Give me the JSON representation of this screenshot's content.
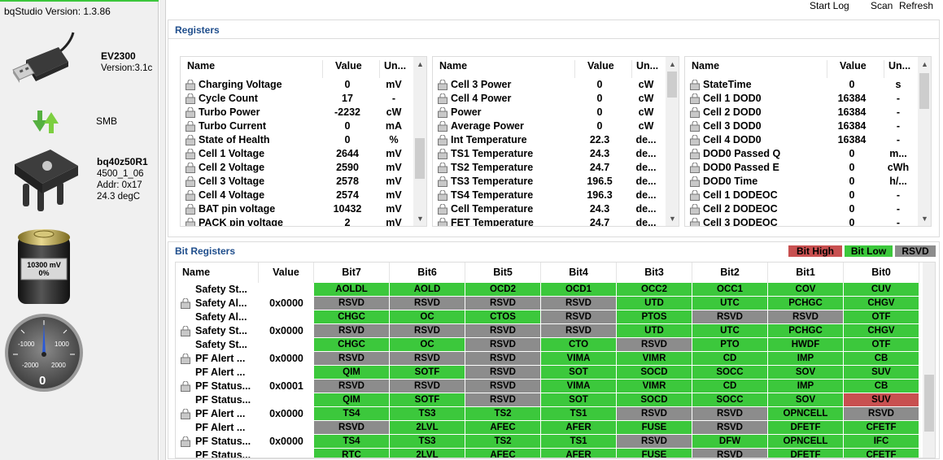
{
  "app": {
    "version_label": "bqStudio Version:",
    "version": "1.3.86"
  },
  "toolbar": {
    "start_log": "Start Log",
    "scan": "Scan",
    "refresh": "Refresh"
  },
  "adapter": {
    "name": "EV2300",
    "version": "Version:3.1c"
  },
  "bus": {
    "label": "SMB"
  },
  "device": {
    "name": "bq40z50R1",
    "fw": "4500_1_06",
    "addr": "Addr: 0x17",
    "temp": "24.3 degC"
  },
  "battery": {
    "voltage": "10300 mV",
    "percent": "0%",
    "level_fraction": 0.0
  },
  "gauge": {
    "ticks": [
      "-1000",
      "1000",
      "-2000",
      "2000"
    ],
    "value": "0",
    "needle_value": 0
  },
  "registers": {
    "title": "Registers",
    "headers": {
      "name": "Name",
      "value": "Value",
      "unit": "Un..."
    },
    "tables": [
      {
        "rows": [
          {
            "name": "Charging Voltage",
            "value": "0",
            "unit": "mV"
          },
          {
            "name": "Cycle Count",
            "value": "17",
            "unit": "-"
          },
          {
            "name": "Turbo Power",
            "value": "-2232",
            "unit": "cW"
          },
          {
            "name": "Turbo Current",
            "value": "0",
            "unit": "mA"
          },
          {
            "name": "State of Health",
            "value": "0",
            "unit": "%"
          },
          {
            "name": "Cell 1 Voltage",
            "value": "2644",
            "unit": "mV"
          },
          {
            "name": "Cell 2 Voltage",
            "value": "2590",
            "unit": "mV"
          },
          {
            "name": "Cell 3 Voltage",
            "value": "2578",
            "unit": "mV"
          },
          {
            "name": "Cell 4 Voltage",
            "value": "2574",
            "unit": "mV"
          },
          {
            "name": "BAT pin voltage",
            "value": "10432",
            "unit": "mV"
          },
          {
            "name": "PACK pin voltage",
            "value": "2",
            "unit": "mV"
          }
        ]
      },
      {
        "rows": [
          {
            "name": "Cell 3 Power",
            "value": "0",
            "unit": "cW"
          },
          {
            "name": "Cell 4 Power",
            "value": "0",
            "unit": "cW"
          },
          {
            "name": "Power",
            "value": "0",
            "unit": "cW"
          },
          {
            "name": "Average Power",
            "value": "0",
            "unit": "cW"
          },
          {
            "name": "Int Temperature",
            "value": "22.3",
            "unit": "de..."
          },
          {
            "name": "TS1 Temperature",
            "value": "24.3",
            "unit": "de..."
          },
          {
            "name": "TS2 Temperature",
            "value": "24.7",
            "unit": "de..."
          },
          {
            "name": "TS3 Temperature",
            "value": "196.5",
            "unit": "de..."
          },
          {
            "name": "TS4 Temperature",
            "value": "196.3",
            "unit": "de..."
          },
          {
            "name": "Cell Temperature",
            "value": "24.3",
            "unit": "de..."
          },
          {
            "name": "FET Temperature",
            "value": "24.7",
            "unit": "de..."
          }
        ]
      },
      {
        "rows": [
          {
            "name": "StateTime",
            "value": "0",
            "unit": "s"
          },
          {
            "name": "Cell 1 DOD0",
            "value": "16384",
            "unit": "-"
          },
          {
            "name": "Cell 2 DOD0",
            "value": "16384",
            "unit": "-"
          },
          {
            "name": "Cell 3 DOD0",
            "value": "16384",
            "unit": "-"
          },
          {
            "name": "Cell 4 DOD0",
            "value": "16384",
            "unit": "-"
          },
          {
            "name": "DOD0 Passed Q",
            "value": "0",
            "unit": "m..."
          },
          {
            "name": "DOD0 Passed E",
            "value": "0",
            "unit": "cWh"
          },
          {
            "name": "DOD0 Time",
            "value": "0",
            "unit": "h/..."
          },
          {
            "name": "Cell 1 DODEOC",
            "value": "0",
            "unit": "-"
          },
          {
            "name": "Cell 2 DODEOC",
            "value": "0",
            "unit": "-"
          },
          {
            "name": "Cell 3 DODEOC",
            "value": "0",
            "unit": "-"
          }
        ]
      }
    ]
  },
  "bit_registers": {
    "title": "Bit Registers",
    "legend": {
      "high": "Bit High",
      "low": "Bit Low",
      "rsvd": "RSVD"
    },
    "headers": [
      "Name",
      "Value",
      "Bit7",
      "Bit6",
      "Bit5",
      "Bit4",
      "Bit3",
      "Bit2",
      "Bit1",
      "Bit0"
    ],
    "colors": {
      "low": "#3cc83c",
      "rsvd": "#8c8c8c",
      "high": "#c85050"
    },
    "rows": [
      {
        "name": "Safety St...",
        "value": "",
        "lock": false,
        "bits": [
          [
            "AOLDL",
            "low"
          ],
          [
            "AOLD",
            "low"
          ],
          [
            "OCD2",
            "low"
          ],
          [
            "OCD1",
            "low"
          ],
          [
            "OCC2",
            "low"
          ],
          [
            "OCC1",
            "low"
          ],
          [
            "COV",
            "low"
          ],
          [
            "CUV",
            "low"
          ]
        ]
      },
      {
        "name": "Safety Al...",
        "value": "0x0000",
        "lock": true,
        "bits": [
          [
            "RSVD",
            "rsvd"
          ],
          [
            "RSVD",
            "rsvd"
          ],
          [
            "RSVD",
            "rsvd"
          ],
          [
            "RSVD",
            "rsvd"
          ],
          [
            "UTD",
            "low"
          ],
          [
            "UTC",
            "low"
          ],
          [
            "PCHGC",
            "low"
          ],
          [
            "CHGV",
            "low"
          ]
        ]
      },
      {
        "name": "Safety Al...",
        "value": "",
        "lock": false,
        "bits": [
          [
            "CHGC",
            "low"
          ],
          [
            "OC",
            "low"
          ],
          [
            "CTOS",
            "low"
          ],
          [
            "RSVD",
            "rsvd"
          ],
          [
            "PTOS",
            "low"
          ],
          [
            "RSVD",
            "rsvd"
          ],
          [
            "RSVD",
            "rsvd"
          ],
          [
            "OTF",
            "low"
          ]
        ]
      },
      {
        "name": "Safety St...",
        "value": "0x0000",
        "lock": true,
        "bits": [
          [
            "RSVD",
            "rsvd"
          ],
          [
            "RSVD",
            "rsvd"
          ],
          [
            "RSVD",
            "rsvd"
          ],
          [
            "RSVD",
            "rsvd"
          ],
          [
            "UTD",
            "low"
          ],
          [
            "UTC",
            "low"
          ],
          [
            "PCHGC",
            "low"
          ],
          [
            "CHGV",
            "low"
          ]
        ]
      },
      {
        "name": "Safety St...",
        "value": "",
        "lock": false,
        "bits": [
          [
            "CHGC",
            "low"
          ],
          [
            "OC",
            "low"
          ],
          [
            "RSVD",
            "rsvd"
          ],
          [
            "CTO",
            "low"
          ],
          [
            "RSVD",
            "rsvd"
          ],
          [
            "PTO",
            "low"
          ],
          [
            "HWDF",
            "low"
          ],
          [
            "OTF",
            "low"
          ]
        ]
      },
      {
        "name": "PF Alert ...",
        "value": "0x0000",
        "lock": true,
        "bits": [
          [
            "RSVD",
            "rsvd"
          ],
          [
            "RSVD",
            "rsvd"
          ],
          [
            "RSVD",
            "rsvd"
          ],
          [
            "VIMA",
            "low"
          ],
          [
            "VIMR",
            "low"
          ],
          [
            "CD",
            "low"
          ],
          [
            "IMP",
            "low"
          ],
          [
            "CB",
            "low"
          ]
        ]
      },
      {
        "name": "PF Alert ...",
        "value": "",
        "lock": false,
        "bits": [
          [
            "QIM",
            "low"
          ],
          [
            "SOTF",
            "low"
          ],
          [
            "RSVD",
            "rsvd"
          ],
          [
            "SOT",
            "low"
          ],
          [
            "SOCD",
            "low"
          ],
          [
            "SOCC",
            "low"
          ],
          [
            "SOV",
            "low"
          ],
          [
            "SUV",
            "low"
          ]
        ]
      },
      {
        "name": "PF Status...",
        "value": "0x0001",
        "lock": true,
        "bits": [
          [
            "RSVD",
            "rsvd"
          ],
          [
            "RSVD",
            "rsvd"
          ],
          [
            "RSVD",
            "rsvd"
          ],
          [
            "VIMA",
            "low"
          ],
          [
            "VIMR",
            "low"
          ],
          [
            "CD",
            "low"
          ],
          [
            "IMP",
            "low"
          ],
          [
            "CB",
            "low"
          ]
        ]
      },
      {
        "name": "PF Status...",
        "value": "",
        "lock": false,
        "bits": [
          [
            "QIM",
            "low"
          ],
          [
            "SOTF",
            "low"
          ],
          [
            "RSVD",
            "rsvd"
          ],
          [
            "SOT",
            "low"
          ],
          [
            "SOCD",
            "low"
          ],
          [
            "SOCC",
            "low"
          ],
          [
            "SOV",
            "low"
          ],
          [
            "SUV",
            "high"
          ]
        ]
      },
      {
        "name": "PF Alert ...",
        "value": "0x0000",
        "lock": true,
        "bits": [
          [
            "TS4",
            "low"
          ],
          [
            "TS3",
            "low"
          ],
          [
            "TS2",
            "low"
          ],
          [
            "TS1",
            "low"
          ],
          [
            "RSVD",
            "rsvd"
          ],
          [
            "RSVD",
            "rsvd"
          ],
          [
            "OPNCELL",
            "low"
          ],
          [
            "RSVD",
            "rsvd"
          ]
        ]
      },
      {
        "name": "PF Alert ...",
        "value": "",
        "lock": false,
        "bits": [
          [
            "RSVD",
            "rsvd"
          ],
          [
            "2LVL",
            "low"
          ],
          [
            "AFEC",
            "low"
          ],
          [
            "AFER",
            "low"
          ],
          [
            "FUSE",
            "low"
          ],
          [
            "RSVD",
            "rsvd"
          ],
          [
            "DFETF",
            "low"
          ],
          [
            "CFETF",
            "low"
          ]
        ]
      },
      {
        "name": "PF Status...",
        "value": "0x0000",
        "lock": true,
        "bits": [
          [
            "TS4",
            "low"
          ],
          [
            "TS3",
            "low"
          ],
          [
            "TS2",
            "low"
          ],
          [
            "TS1",
            "low"
          ],
          [
            "RSVD",
            "rsvd"
          ],
          [
            "DFW",
            "low"
          ],
          [
            "OPNCELL",
            "low"
          ],
          [
            "IFC",
            "low"
          ]
        ]
      },
      {
        "name": "PF Status...",
        "value": "",
        "lock": false,
        "bits": [
          [
            "RTC",
            "low"
          ],
          [
            "2LVL",
            "low"
          ],
          [
            "AFEC",
            "low"
          ],
          [
            "AFER",
            "low"
          ],
          [
            "FUSE",
            "low"
          ],
          [
            "RSVD",
            "rsvd"
          ],
          [
            "DFETF",
            "low"
          ],
          [
            "CFETF",
            "low"
          ]
        ]
      }
    ]
  }
}
